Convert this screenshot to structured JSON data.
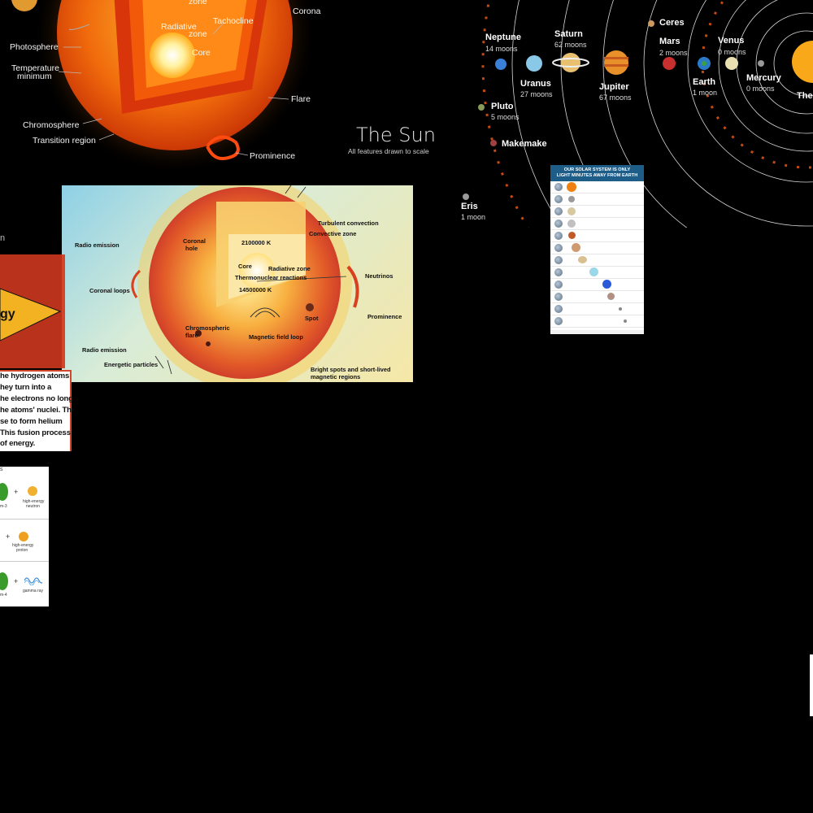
{
  "sun_cutaway": {
    "title": "The Sun",
    "subtitle": "All features drawn to scale",
    "labels": {
      "zone": "zone",
      "corona": "Corona",
      "tachocline": "Tachocline",
      "radiative_zone_1": "Radiative",
      "radiative_zone_2": "zone",
      "core": "Core",
      "photosphere": "Photosphere",
      "temp_min_1": "Temperature",
      "temp_min_2": "minimum",
      "flare": "Flare",
      "chromosphere": "Chromosphere",
      "transition_region": "Transition region",
      "prominence": "Prominence"
    }
  },
  "solar_system": {
    "planets": {
      "neptune": {
        "name": "Neptune",
        "moons": "14 moons"
      },
      "saturn": {
        "name": "Saturn",
        "moons": "62 moons"
      },
      "ceres": {
        "name": "Ceres"
      },
      "mars": {
        "name": "Mars",
        "moons": "2 moons"
      },
      "venus": {
        "name": "Venus",
        "moons": "0 moons"
      },
      "uranus": {
        "name": "Uranus",
        "moons": "27 moons"
      },
      "jupiter": {
        "name": "Jupiter",
        "moons": "67 moons"
      },
      "earth": {
        "name": "Earth",
        "moons": "1 moon"
      },
      "mercury": {
        "name": "Mercury",
        "moons": "0 moons"
      },
      "sun": {
        "name": "The"
      },
      "pluto": {
        "name": "Pluto",
        "moons": "5 moons"
      },
      "makemake": {
        "name": "Makemake"
      },
      "eris": {
        "name": "Eris",
        "moons": "1 moon"
      }
    }
  },
  "light_minutes": {
    "header_1": "OUR SOLAR SYSTEM IS ONLY",
    "header_2": "LIGHT MINUTES AWAY FROM EARTH"
  },
  "sun_structure": {
    "labels": {
      "turbulent_convection": "Turbulent convection",
      "convective_zone": "Convective zone",
      "radio_emission_1": "Radio emission",
      "coronal_hole_1": "Coronal",
      "coronal_hole_2": "hole",
      "temp_2100000": "2100000 K",
      "core": "Core",
      "radiative_zone": "Radiative zone",
      "thermonuclear": "Thermonuclear reactions",
      "temp_14500000": "14500000 K",
      "neutrinos": "Neutrinos",
      "coronal_loops": "Coronal loops",
      "spot": "Spot",
      "prominence": "Prominence",
      "chromospheric_1": "Chromospheric",
      "chromospheric_2": "flare",
      "magnetic_field_loop": "Magnetic field loop",
      "radio_emission_2": "Radio emission",
      "energetic_particles": "Energetic particles",
      "bright_spots_1": "Bright spots and short-lived",
      "bright_spots_2": "magnetic regions"
    }
  },
  "energy_panel": {
    "banner": "gy",
    "side_mark": "n",
    "lines": [
      "he hydrogen atoms",
      "hey turn into a",
      "he electrons no longer",
      "he atoms' nuclei. The",
      "se to form helium",
      "This fusion process",
      "of energy."
    ]
  },
  "fusion_panel": {
    "top_mark": "s",
    "rows": [
      {
        "left": "m-3",
        "right_1": "high-energy",
        "right_2": "neutron"
      },
      {
        "left": "",
        "right_1": "high-energy",
        "right_2": "proton"
      },
      {
        "left": "m-4",
        "right_1": "gamma ray",
        "right_2": ""
      }
    ],
    "plus": "+"
  },
  "colors": {
    "sun_orange": "#f47a12",
    "sun_core": "#fff7c0",
    "border_red": "#d4452a",
    "infographic_blue": "#1d5d88"
  }
}
